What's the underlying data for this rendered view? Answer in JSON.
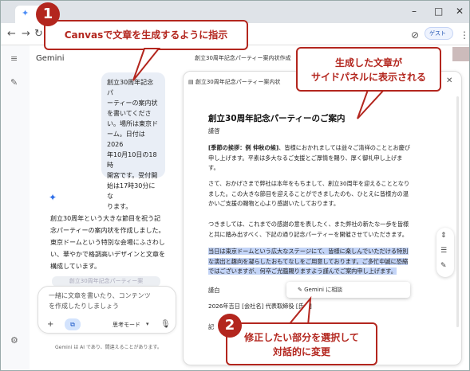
{
  "browser": {
    "guest_label": "ゲスト"
  },
  "app": {
    "title": "Gemini"
  },
  "chat": {
    "user_message_lines": [
      "創立30周年記念パ",
      "ーティーの案内状",
      "を書いてくださ",
      "い。場所は東京ド",
      "ーム。日付は2026",
      "年10月10日の18時",
      "開宮です。受付開",
      "始は17時30分にな",
      "ります。"
    ],
    "reply_lines": [
      "創立30周年という大きな節目を祝う記",
      "念パーティーの案内状を作成しました。",
      "東京ドームという特別な会場にふさわし",
      "い、華やかで格調高いデザインと文章を",
      "構成しています。"
    ],
    "doc_chip": "創立30周年記念パーティー案",
    "input_placeholder_lines": [
      "一緒に文章を書いたり、コンテンツ",
      "を作成したりしましょう"
    ],
    "think_label": "思考モード",
    "disclaimer": "Gemini は AI であり、間違えることがあります。"
  },
  "canvas": {
    "header_title": "創立30周年記念パーティー案内状作成",
    "panel_title": "創立30周年記念パーティー案内状",
    "doc_title": "創立30周年記念パーティーのご案内",
    "salutation": "謹啓",
    "para1_bold": "[季節の挨拶：例 仲秋の候]",
    "para1_lines": [
      "、皆様におかれましては益々ご清祥のこととお慶び",
      "申し上げます。平素は多大なるご支援とご厚情を賜り、厚く御礼申し上げま",
      "す。"
    ],
    "para2_lines": [
      "さて、おかげさまで弊社は本年をもちまして、創立30周年を迎えることとなり",
      "ました。この大きな節目を迎えることができましたのも、ひとえに皆様方の温",
      "かいご支援の賜物と心より感謝いたしております。"
    ],
    "para3_lines": [
      "つきましては、これまでの感謝の意を表したく、また弊社の新たな一歩を皆様",
      "と共に踏み出すべく、下記の通り記念パーティーを開催させていただきます。"
    ],
    "para4_lines": [
      "当日は東京ドームという広大なステージにて、皆様に楽しんでいただける特別",
      "な演出と趣向を凝らしたおもてなしをご用意しております。ご多忙中誠に恐縮",
      "ではございますが、何卒ご光臨賜りますよう謹んでご案内申し上げます。"
    ],
    "closing": "謹白",
    "sign": "2026年吉日 [会社名] 代表取締役 [氏名]",
    "trail": "記",
    "ask_label": "Gemini に相談"
  },
  "callouts": [
    {
      "number": "1",
      "text": "Canvasで文章を生成するように指示"
    },
    {
      "number": "",
      "text_lines": [
        "生成した文章が",
        "サイドパネルに表示される"
      ]
    },
    {
      "number": "2",
      "text_lines": [
        "修正したい部分を選択して",
        "対話的に変更"
      ]
    }
  ],
  "colors": {
    "callout": "#b3261e",
    "highlight": "#c3d4f7",
    "accent": "#1a57c7"
  }
}
